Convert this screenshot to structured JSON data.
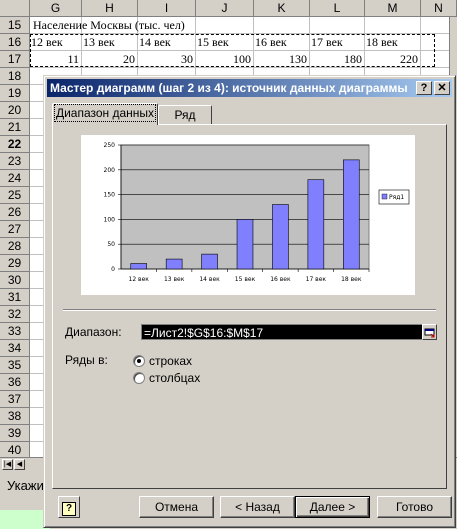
{
  "spreadsheet": {
    "columns": [
      "G",
      "H",
      "I",
      "J",
      "K",
      "L",
      "M",
      "N"
    ],
    "rows": [
      "15",
      "16",
      "17",
      "18",
      "19",
      "20",
      "21",
      "22",
      "23",
      "24",
      "25",
      "26",
      "27",
      "28",
      "29",
      "30",
      "31",
      "32",
      "33",
      "34",
      "35",
      "36",
      "37",
      "38",
      "39",
      "40"
    ],
    "active_row": "22",
    "title_cell": "Население Москвы (тыс. чел)",
    "centuries": [
      "12 век",
      "13 век",
      "14 век",
      "15 век",
      "16 век",
      "17 век",
      "18 век"
    ],
    "values": [
      "11",
      "20",
      "30",
      "100",
      "130",
      "180",
      "220"
    ]
  },
  "status_bar": {
    "text": "Укажите"
  },
  "dialog": {
    "title": "Мастер диаграмм (шаг 2 из 4): источник данных диаграммы",
    "help_glyph": "?",
    "close_glyph": "✕",
    "tabs": [
      {
        "label": "Диапазон данных",
        "active": true
      },
      {
        "label": "Ряд",
        "active": false
      }
    ],
    "range_label": "Диапазон:",
    "range_value": "=Лист2!$G$16:$M$17",
    "series_in_label": "Ряды в:",
    "options": [
      {
        "label": "строках",
        "selected": true
      },
      {
        "label": "столбцах",
        "selected": false
      }
    ],
    "buttons": {
      "help": "?",
      "cancel": "Отмена",
      "back": "< Назад",
      "next": "Далее >",
      "finish": "Готово"
    }
  },
  "chart_data": {
    "type": "bar",
    "categories": [
      "12 век",
      "13 век",
      "14 век",
      "15 век",
      "16 век",
      "17 век",
      "18 век"
    ],
    "series": [
      {
        "name": "Ряд1",
        "values": [
          11,
          20,
          30,
          100,
          130,
          180,
          220
        ]
      }
    ],
    "ylim": [
      0,
      250
    ],
    "yticks": [
      0,
      50,
      100,
      150,
      200,
      250
    ],
    "grid": true,
    "legend": "right",
    "colors": {
      "bar": "#8080ff",
      "plot_bg": "#c0c0c0",
      "gridline": "#000000"
    }
  }
}
